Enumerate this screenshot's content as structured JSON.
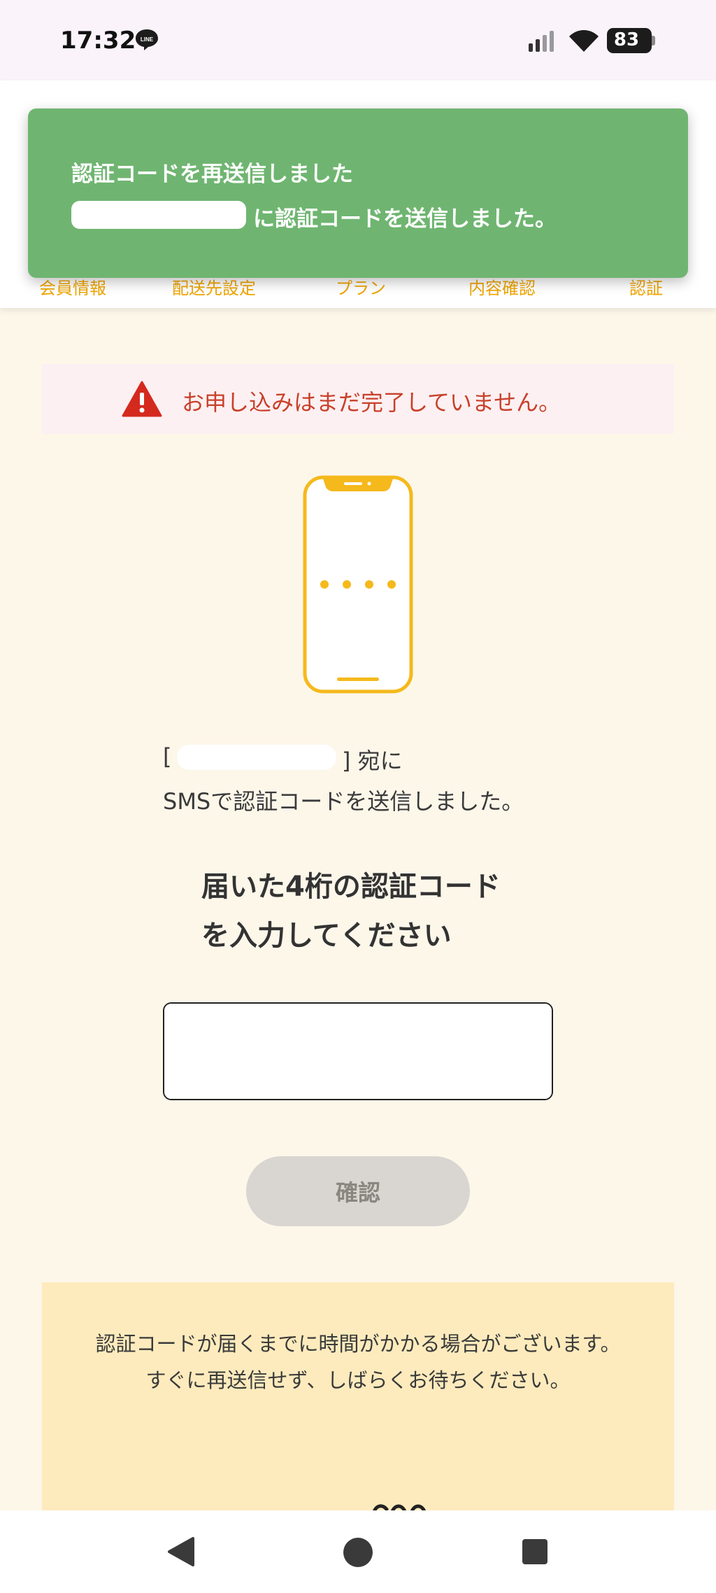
{
  "status_bar": {
    "time": "17:32",
    "battery": "83",
    "icons": [
      "line-icon",
      "signal-icon",
      "wifi-icon",
      "battery-icon"
    ]
  },
  "steps": [
    {
      "label": "会員情報"
    },
    {
      "label": "配送先設定"
    },
    {
      "label": "プラン"
    },
    {
      "label": "内容確認"
    },
    {
      "label": "認証"
    }
  ],
  "toast": {
    "title": "認証コードを再送信しました",
    "message": "に認証コードを送信しました。",
    "color": "#6fb571"
  },
  "warning": {
    "text": "お申し込みはまだ完了していません。",
    "icon": "warning-triangle-icon",
    "color": "#c8412a"
  },
  "sent": {
    "bracket_open": "[",
    "suffix": "] 宛に",
    "line2": "SMSで認証コードを送信しました。"
  },
  "heading": {
    "line1": "届いた4桁の認証コード",
    "line2": "を入力してください"
  },
  "code_input": {
    "digits": [
      "",
      "",
      "",
      ""
    ]
  },
  "confirm_button": {
    "label": "確認"
  },
  "notice": {
    "line1": "認証コードが届くまでに時間がかかる場合がございます。",
    "line2": "すぐに再送信せず、しばらくお待ちください。"
  },
  "colors": {
    "accent": "#f5b91c",
    "background": "#fdf7ea",
    "notice_bg": "#fdebbd"
  }
}
